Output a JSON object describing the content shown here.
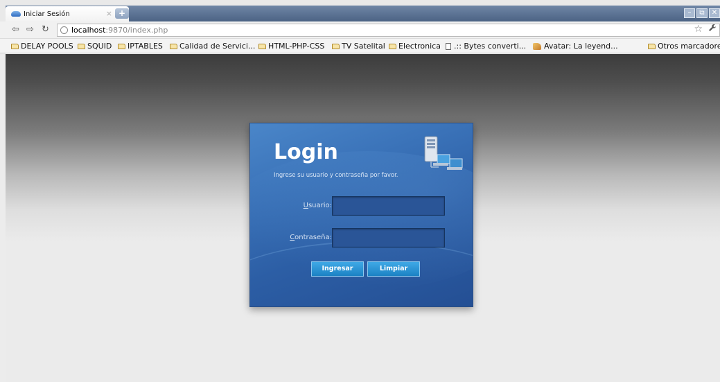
{
  "browser": {
    "tab_title": "Iniciar Sesión",
    "tab_close": "×",
    "new_tab": "+",
    "window_controls": [
      "–",
      "⧉",
      "✕"
    ]
  },
  "toolbar": {
    "back_icon": "⇦",
    "forward_icon": "⇨",
    "reload_icon": "↻",
    "url_host": "localhost",
    "url_rest": ":9870/index.php",
    "star_icon": "☆",
    "wrench_icon": "🔧"
  },
  "bookmarks": {
    "items": [
      {
        "label": "DELAY POOLS",
        "icon": "folder"
      },
      {
        "label": "SQUID",
        "icon": "folder"
      },
      {
        "label": "IPTABLES",
        "icon": "folder"
      },
      {
        "label": "Calidad de Servici...",
        "icon": "folder"
      },
      {
        "label": "HTML-PHP-CSS",
        "icon": "folder"
      },
      {
        "label": "TV Satelital",
        "icon": "folder"
      },
      {
        "label": "Electronica",
        "icon": "folder"
      },
      {
        "label": ".:: Bytes converti...",
        "icon": "page"
      },
      {
        "label": "Avatar: La leyend...",
        "icon": "avatar"
      }
    ],
    "other": "Otros marcadores"
  },
  "login": {
    "title": "Login",
    "subtitle": "Ingrese su usuario y contraseña por favor.",
    "user_label_accesskey": "U",
    "user_label_rest": "suario:",
    "password_label_accesskey": "C",
    "password_label_rest": "ontraseña:",
    "user_value": "",
    "password_value": "",
    "submit_label": "Ingresar",
    "clear_label": "Limpiar"
  },
  "colors": {
    "card_blue": "#2c5ea5",
    "button_blue": "#1c82c4"
  }
}
